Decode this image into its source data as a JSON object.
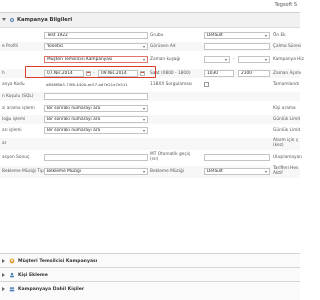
{
  "brand": "Tegsoft S",
  "panel": {
    "title": "Kampanya Bilgileri"
  },
  "form": {
    "row1": {
      "value": "Test 1922",
      "label2": "Grubu",
      "select2": "Default",
      "label3": "Ön Ek"
    },
    "row2": {
      "label1": "e Profili",
      "select1": "Yönetici",
      "label2": "Görünen Ad",
      "label3": "Çalma Süresi"
    },
    "row3": {
      "label1": "",
      "select1": "Müşteri Temsilcisi Kampanyası",
      "label2": "Zaman kuşağı",
      "dash": "-",
      "label3": "Kampanya Hiz"
    },
    "row4": {
      "label1": "h",
      "date_from": "07.Nis.2014",
      "date_to": "09.Nis.2014",
      "label2": "Saat (0800 - 1800)",
      "time_from": "1030",
      "time_to": "2100",
      "label3": "Zaman Aşımı"
    },
    "row5": {
      "label1": "anya Kodu",
      "uuid": "d856f8b3-73f6-4400-ac57-ad7e21a7e511",
      "label2": "11BXX Sorgulaması",
      "label3": "Tamamlandı"
    },
    "row6": {
      "label1": "n Koşulu (SQL)"
    },
    "row7": {
      "label1": "si arama işlemi",
      "select1": "Bir sonraki numarayı ara",
      "label3": "Kişi arama"
    },
    "row8": {
      "label1": "loğu işlemi",
      "select1": "Bir sonraki numarayı ara",
      "label3": "Günlük Limit"
    },
    "row9": {
      "label1": "arı işlemi",
      "select1": "Bir sonraki numarayı ara",
      "label3": "Günlük Limit"
    },
    "row10": {
      "label1": "ar",
      "label3a": "Alarm için ç",
      "label3b": "(kez)"
    },
    "row11": {
      "label1": "asyon Sonuç",
      "label2a": "MT Otomatik geçiş",
      "label2b": "(sn)",
      "label3": "Ulaşılamayan"
    },
    "row12": {
      "label1": "Bekleme Müziği Tipi",
      "select1": "Bekleme Müziği",
      "label2": "Bekleme Müziği",
      "select2": "Default",
      "label3a": "Tarifleri Hes",
      "label3b": "Aktif"
    }
  },
  "sections": [
    {
      "label": "Müşteri Temsilcisi Kampanyası"
    },
    {
      "label": "Kişi Ekleme"
    },
    {
      "label": "Kampanyaya Dahil Kişiler"
    }
  ],
  "colors": {
    "highlight": "#d93a2b",
    "header_bg": "#f1f1f1"
  }
}
